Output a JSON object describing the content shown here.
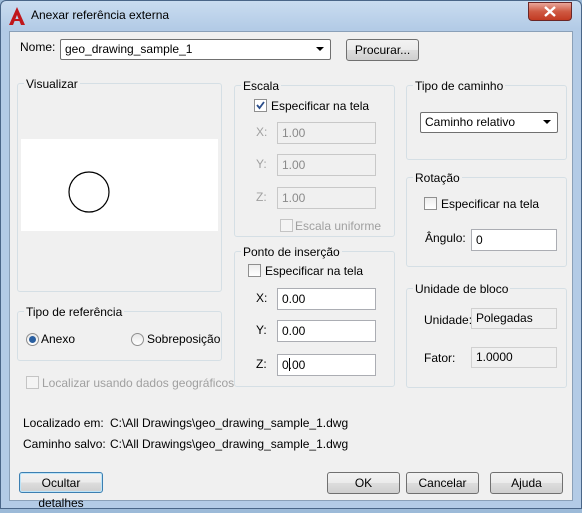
{
  "window": {
    "title": "Anexar referência externa"
  },
  "colors": {
    "client_bg": "#f0f0f0",
    "title_bg": "#b3cbe6",
    "close_red": "#c23a22",
    "app_icon_red": "#c0161b"
  },
  "name_row": {
    "label": "Nome:",
    "selected": "geo_drawing_sample_1",
    "browse_button": "Procurar..."
  },
  "preview": {
    "title": "Visualizar"
  },
  "ref_type": {
    "title": "Tipo de referência",
    "options": [
      "Anexo",
      "Sobreposição"
    ],
    "selected": "Anexo"
  },
  "geo_locate": {
    "label": "Localizar usando dados geográficos",
    "checked": false,
    "enabled": false
  },
  "scale": {
    "title": "Escala",
    "specify_on_screen": {
      "label": "Especificar na tela",
      "checked": true
    },
    "x": {
      "label": "X:",
      "value": "1.00"
    },
    "y": {
      "label": "Y:",
      "value": "1.00"
    },
    "z": {
      "label": "Z:",
      "value": "1.00"
    },
    "uniform": {
      "label": "Escala uniforme",
      "checked": false
    }
  },
  "insertion": {
    "title": "Ponto de inserção",
    "specify_on_screen": {
      "label": "Especificar na tela",
      "checked": false
    },
    "x": {
      "label": "X:",
      "value": "0.00"
    },
    "y": {
      "label": "Y:",
      "value": "0.00"
    },
    "z": {
      "label": "Z:",
      "value": "0.00"
    }
  },
  "path_type": {
    "title": "Tipo de caminho",
    "selected": "Caminho relativo"
  },
  "rotation": {
    "title": "Rotação",
    "specify_on_screen": {
      "label": "Especificar na tela",
      "checked": false
    },
    "angle": {
      "label": "Ângulo:",
      "value": "0"
    }
  },
  "block_unit": {
    "title": "Unidade de bloco",
    "unit": {
      "label": "Unidade:",
      "value": "Polegadas"
    },
    "factor": {
      "label": "Fator:",
      "value": "1.0000"
    }
  },
  "paths": {
    "found_in": {
      "label": "Localizado em:",
      "value": "C:\\All Drawings\\geo_drawing_sample_1.dwg"
    },
    "saved": {
      "label": "Caminho salvo:",
      "value": "C:\\All Drawings\\geo_drawing_sample_1.dwg"
    }
  },
  "buttons": {
    "hide_details": "Ocultar detalhes",
    "ok": "OK",
    "cancel": "Cancelar",
    "help": "Ajuda"
  }
}
